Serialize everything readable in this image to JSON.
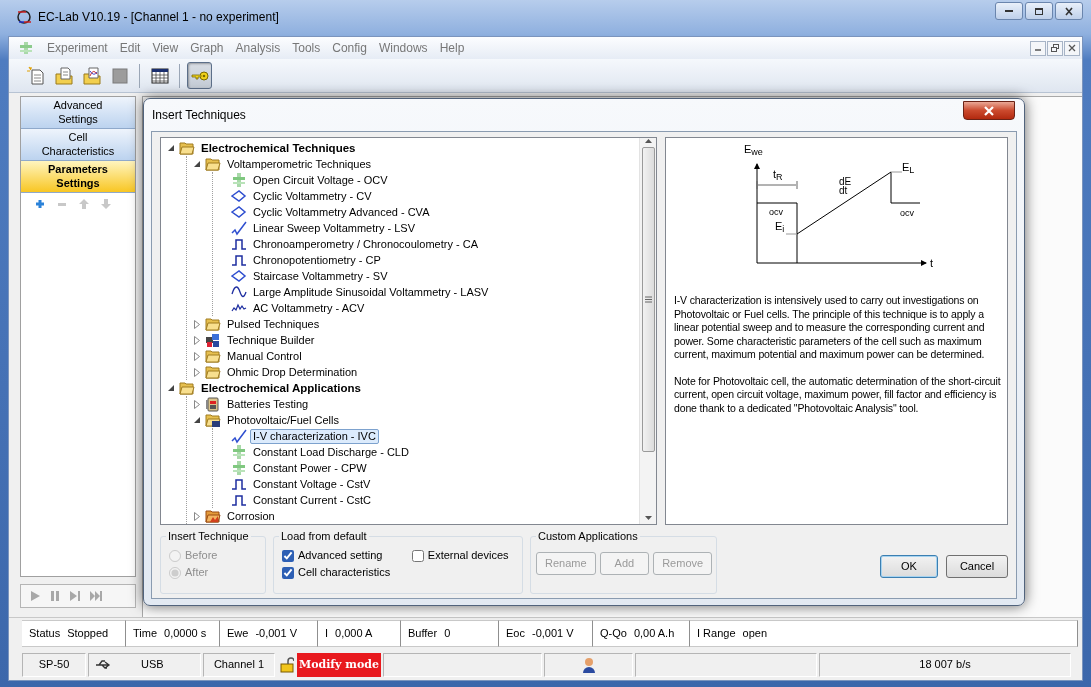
{
  "window": {
    "title": "EC-Lab V10.19 - [Channel 1 - no experiment]"
  },
  "menu": [
    "Experiment",
    "Edit",
    "View",
    "Graph",
    "Analysis",
    "Tools",
    "Config",
    "Windows",
    "Help"
  ],
  "toolbar": [
    {
      "kind": "new",
      "pressed": false
    },
    {
      "kind": "open",
      "pressed": false
    },
    {
      "kind": "graph",
      "pressed": false
    },
    {
      "kind": "stop",
      "pressed": false
    },
    {
      "kind": "table",
      "pressed": false
    },
    {
      "kind": "key",
      "pressed": true
    }
  ],
  "sidebar": {
    "tabs": [
      {
        "label": "Advanced Settings",
        "selected": false
      },
      {
        "label": "Cell Characteristics",
        "selected": false
      },
      {
        "label": "Parameters Settings",
        "selected": true
      }
    ]
  },
  "dialog": {
    "title": "Insert Techniques",
    "tree": [
      {
        "label": "Electrochemical Techniques",
        "kind": "folder",
        "selected": false,
        "expanded": true,
        "children": [
          {
            "label": "Voltamperometric Techniques",
            "kind": "folder",
            "selected": false,
            "expanded": true,
            "children": [
              {
                "label": "Open Circuit Voltage - OCV",
                "kind": "cell",
                "selected": false
              },
              {
                "label": "Cyclic Voltammetry - CV",
                "kind": "loop",
                "selected": false
              },
              {
                "label": "Cyclic Voltammetry Advanced - CVA",
                "kind": "loop",
                "selected": false
              },
              {
                "label": "Linear Sweep Voltammetry - LSV",
                "kind": "ramp",
                "selected": false
              },
              {
                "label": "Chronoamperometry / Chronocoulometry - CA",
                "kind": "pulse",
                "selected": false
              },
              {
                "label": "Chronopotentiometry - CP",
                "kind": "pulse",
                "selected": false
              },
              {
                "label": "Staircase Voltammetry - SV",
                "kind": "loop",
                "selected": false
              },
              {
                "label": "Large Amplitude Sinusoidal Voltammetry - LASV",
                "kind": "sine",
                "selected": false
              },
              {
                "label": "AC Voltammetry - ACV",
                "kind": "wave",
                "selected": false
              }
            ]
          },
          {
            "label": "Pulsed Techniques",
            "kind": "folder",
            "selected": false,
            "expanded": false
          },
          {
            "label": "Technique Builder",
            "kind": "builder",
            "selected": false,
            "expanded": false
          },
          {
            "label": "Manual Control",
            "kind": "folder",
            "selected": false,
            "expanded": false
          },
          {
            "label": "Ohmic Drop Determination",
            "kind": "folder",
            "selected": false,
            "expanded": false
          }
        ]
      },
      {
        "label": "Electrochemical Applications",
        "kind": "folder",
        "selected": false,
        "expanded": true,
        "children": [
          {
            "label": "Batteries Testing",
            "kind": "battery",
            "selected": false,
            "expanded": false
          },
          {
            "label": "Photovoltaic/Fuel Cells",
            "kind": "solar",
            "selected": false,
            "expanded": true,
            "children": [
              {
                "label": "I-V characterization - IVC",
                "kind": "ramp",
                "selected": true
              },
              {
                "label": "Constant Load Discharge - CLD",
                "kind": "cell",
                "selected": false
              },
              {
                "label": "Constant Power - CPW",
                "kind": "cell",
                "selected": false
              },
              {
                "label": "Constant Voltage - CstV",
                "kind": "pulse",
                "selected": false
              },
              {
                "label": "Constant Current - CstC",
                "kind": "pulse",
                "selected": false
              }
            ]
          },
          {
            "label": "Corrosion",
            "kind": "corrosion",
            "selected": false,
            "expanded": false
          }
        ]
      }
    ],
    "diagram_labels": [
      "E$_{we}$",
      "t$_{R}$",
      "dE",
      "dt",
      "E$_{L}$",
      "ocv",
      "E$_{i}$",
      "ocv",
      "t"
    ],
    "description": [
      "I-V characterization is intensively used to carry out investigations on Photovoltaic or Fuel cells. The principle of this technique is to apply a linear potential sweep and to measure the corresponding current and power. Some characteristic parameters of the cell such as maximum current, maximum potential and maximum power can be determined.",
      "Note for Photovoltaic cell, the automatic determination of the short-circuit current, open circuit voltage, maximum power, fill factor and efficiency is done thank to a dedicated \"Photovoltaic Analysis\" tool."
    ],
    "insert_technique": {
      "title": "Insert Technique",
      "options": [
        {
          "label": "Before",
          "selected": false,
          "disabled": true
        },
        {
          "label": "After",
          "selected": true,
          "disabled": true
        }
      ]
    },
    "load_from_default": {
      "title": "Load from default",
      "options": [
        {
          "label": "Advanced setting",
          "checked": true
        },
        {
          "label": "Cell characteristics",
          "checked": true
        },
        {
          "label": "External devices",
          "checked": false
        }
      ]
    },
    "custom_applications": {
      "title": "Custom Applications",
      "buttons": [
        {
          "label": "Rename",
          "disabled": true
        },
        {
          "label": "Add",
          "disabled": true
        },
        {
          "label": "Remove",
          "disabled": true
        }
      ]
    },
    "buttons": [
      "OK",
      "Cancel"
    ]
  },
  "status_bar": [
    {
      "label": "Status",
      "value": "Stopped"
    },
    {
      "label": "Time",
      "value": "0,0000 s"
    },
    {
      "label": "Ewe",
      "value": "-0,001 V"
    },
    {
      "label": "I",
      "value": "0,000 A"
    },
    {
      "label": "Buffer",
      "value": "0"
    },
    {
      "label": "Eoc",
      "value": "-0,001 V"
    },
    {
      "label": "Q-Qo",
      "value": "0,00 A.h"
    },
    {
      "label": "I Range",
      "value": "open"
    }
  ],
  "connection_bar": {
    "device": "SP-50",
    "connection": "USB",
    "channel": "Channel 1",
    "mode": "Modify mode",
    "rate": "18 007 b/s"
  }
}
